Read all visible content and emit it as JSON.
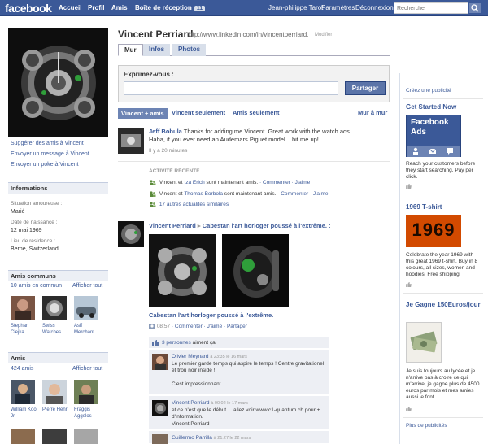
{
  "topbar": {
    "logo": "facebook",
    "nav": [
      "Accueil",
      "Profil",
      "Amis"
    ],
    "inbox_label": "Boîte de réception",
    "inbox_count": "11",
    "user_name": "Jean-philippe Tarot",
    "settings": "Paramètres",
    "logout": "Déconnexion",
    "search_placeholder": "Recherche"
  },
  "profile": {
    "name": "Vincent Perriard",
    "url": "http://www.linkedin.com/in/vincentperriard.",
    "edit": "Modifier",
    "tabs": [
      "Mur",
      "Infos",
      "Photos"
    ]
  },
  "left": {
    "links": [
      "Suggérer des amis à Vincent",
      "Envoyer un message à Vincent",
      "Envoyer un poke à Vincent"
    ],
    "info": {
      "header": "Informations",
      "relationship_label": "Situation amoureuse :",
      "relationship": "Marié",
      "birthday_label": "Date de naissance :",
      "birthday": "12 mai 1969",
      "hometown_label": "Lieu de résidence :",
      "hometown": "Berne, Switzerland"
    },
    "mutual": {
      "header": "Amis communs",
      "count": "10 amis en commun",
      "see_all": "Afficher tout",
      "items": [
        "Stephan Ciejka",
        "Swiss Watches",
        "Asif Merchant"
      ]
    },
    "friends": {
      "header": "Amis",
      "count": "424 amis",
      "see_all": "Afficher tout",
      "items": [
        "William Koo Jr",
        "Pierre Henri",
        "Fraggis Aggelos"
      ]
    }
  },
  "composer": {
    "label": "Exprimez-vous :",
    "share": "Partager"
  },
  "filters": [
    "Vincent + amis",
    "Vincent seulement",
    "Amis seulement",
    "Mur à mur"
  ],
  "feed": {
    "post1": {
      "author": "Jeff Bobula",
      "text": "Thanks for adding me Vincent. Great work with the watch ads. Haha, if you ever need an Audemars Piguet model....hit me up!",
      "time": "Il y a 20 minutes"
    },
    "recent": {
      "header": "ACTIVITÉ RÉCENTE",
      "line1_a": "Vincent et",
      "line1_name": "Iza Erich",
      "line1_b": "sont maintenant amis.",
      "line2_a": "Vincent et",
      "line2_name": "Thomas Borbola",
      "line2_b": "sont maintenant amis.",
      "actions": "· Commenter · J'aime",
      "more": "17 autres actualités similaires"
    },
    "post2": {
      "author": "Vincent Perriard",
      "arrow": "▸",
      "target": "Cabestan l'art horloger poussé à l'extrême. :",
      "caption": "Cabestan l'art horloger poussé à l'extrême.",
      "time": "08:57",
      "actions": "· Commenter · J'aime · Partager",
      "likes": "3 personnes",
      "likes_suffix": "aiment ça."
    },
    "comments": [
      {
        "author": "Olivier Meynard",
        "time": "à 23:35 le 16 mars",
        "text": "Le premier garde temps qui aspire le temps ! Centre gravitationel et trou noir inside !",
        "text2": "C'est impressionnant."
      },
      {
        "author": "Vincent Perriard",
        "time": "à 00:02 le 17 mars",
        "text": "et ce n'est que le début.... allez voir www.c1-quantum.ch pour + d'information.",
        "text2": "Vincent Perriard"
      },
      {
        "author": "Guillermo Parrilla",
        "time": "à 21:27 le 22 mars",
        "text": "",
        "text2": ""
      }
    ]
  },
  "right": {
    "create_ad": "Créez une publicité",
    "ads": [
      {
        "title": "Get Started Now",
        "image_text": "Facebook Ads",
        "text": "Reach your customers before they start searching. Pay per click."
      },
      {
        "title": "1969 T-shirt",
        "image_text": "1969",
        "text": "Celebrate the year 1969 with this great 1969 t-shirt. Buy in 8 colours, all sizes, women and hoodies. Free shipping."
      },
      {
        "title": "Je Gagne 150Euros/jour",
        "text": "Je suis toujours au lycée et je n'arrive pas à croire ce qui m'arrive, je gagne plus de 4500 euros par mois et mes amies aussi le font"
      }
    ],
    "more_ads": "Plus de publicités"
  },
  "colors": {
    "brand": "#3b5998",
    "accent_bg": "#eceff5",
    "share_button": "#5b74a8",
    "ad_1969": "#d24a00"
  }
}
